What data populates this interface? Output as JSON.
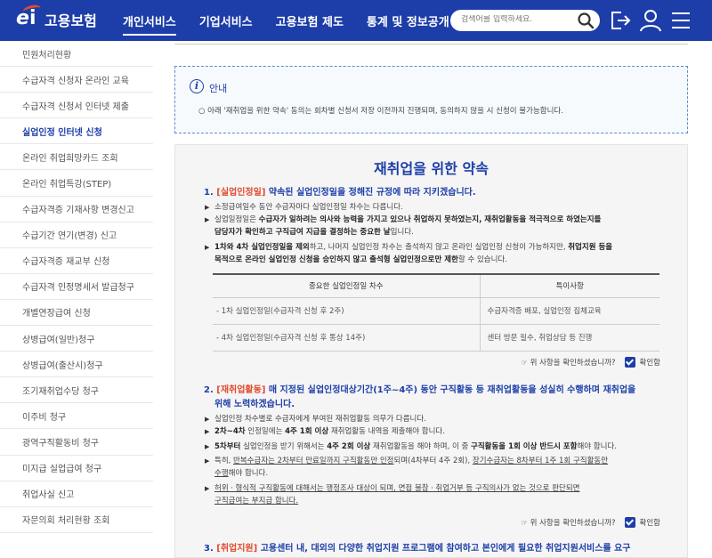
{
  "header": {
    "logo_text": "고용보험",
    "nav": [
      "개인서비스",
      "기업서비스",
      "고용보험 제도",
      "통계 및 정보공개"
    ],
    "search_placeholder": "검색어를 입력하세요."
  },
  "sidebar": {
    "items": [
      "민원처리현황",
      "수급자격 신청자 온라인 교육",
      "수급자격 신청서 인터넷 제출",
      "실업인정 인터넷 신청",
      "온라인 취업희망카드 조회",
      "온라인 취업특강(STEP)",
      "수급자격증 기재사항 변경신고",
      "수급기간 연기(변경) 신고",
      "수급자격증 재교부 신청",
      "수급자격 인정명세서 발급청구",
      "개별연장급여 신청",
      "상병급여(일반)청구",
      "상병급여(출산시)청구",
      "조기재취업수당 청구",
      "이주비 청구",
      "광역구직활동비 청구",
      "미지급 실업급여 청구",
      "취업사실 신고",
      "자문의회 처리현황 조회"
    ]
  },
  "notice": {
    "title": "안내",
    "text": "○ 아래 '재취업을 위한 약속' 동의는 회차별 신청서 저장 이전까지 진행되며, 동의하지 않을 시 신청이 불가능합니다."
  },
  "pledge": {
    "title": "재취업을 위한 약속",
    "s1": {
      "num": "1.",
      "tag": "[실업인정일]",
      "title": "약속된 실업인정일을 정해진 규정에 따라 지키겠습니다.",
      "b1": "소정급여일수 동안 수급자마다 실업인정일 차수는 다릅니다.",
      "b2a": "실업일정일은 ",
      "b2b": "수급자가 일하려는 의사와 능력을 가지고 있으나 취업하지 못하였는지, 재취업활동을 적극적으로 하였는지를",
      "b2c": "담당자가 확인하고 구직급여 지급을 결정하는 중요한 날",
      "b2d": "입니다.",
      "b3a": "1차와 4차 실업인정일을 제외",
      "b3b": "하고, 나머지 실업인정 차수는 출석하지 않고 온라인 실업인정 신청이 가능하지만, ",
      "b3c": "취업지원 등을",
      "b3d": "목적으로 온라인 실업인정 신청을 승인하지 않고 출석형 실업인정으로만 제한",
      "b3e": "할 수 있습니다.",
      "table": {
        "headers": [
          "중요한 실업인정일 차수",
          "특이사항"
        ],
        "rows": [
          [
            "- 1차 실업인정일(수급자격 신청 후 2주)",
            "수급자격증 배포, 실업인정 집체교육"
          ],
          [
            "- 4차 실업인정일(수급자격 신청 후 통상 14주)",
            "센터 방문 필수, 취업상담 등 진행"
          ]
        ]
      },
      "confirm": "☞ 위 사항을 확인하셨습니까?",
      "check": "확인함"
    },
    "s2": {
      "num": "2.",
      "tag": "[재취업활동]",
      "title1": "매 지정된 실업인정대상기간(1주~4주) 동안 구직활동 등 재취업활동을 성실히 수행하며 재취업을",
      "title2": "위해 노력하겠습니다.",
      "b1": "실업인정 차수별로 수급자에게 부여된 재취업활동 의무가 다릅니다.",
      "b2a": "2차~4차",
      "b2b": " 인정일에는 ",
      "b2c": "4주 1회 이상",
      "b2d": " 재취업활동 내역을 제출해야 합니다.",
      "b3a": "5차부터",
      "b3b": " 실업인정을 받기 위해서는 ",
      "b3c": "4주 2회 이상",
      "b3d": " 재취업활동을 해야 하며, 이 중 ",
      "b3e": "구직활동을 1회 이상 반드시 포함",
      "b3f": "해야 합니다.",
      "b4a": "특히, ",
      "b4b": "반복수급자는 2차부터 만료일까지 구직활동만 인정",
      "b4c": "되며(4차부터 4주 2회), ",
      "b4d": "장기수급자는 8차부터 1주 1회 구직활동만",
      "b4e": "수행",
      "b4f": "해야 합니다.",
      "b5a": "허위ㆍ형식적 구직활동에 대해서는 행정조사 대상이 되며, 면접 불참ㆍ취업거부 등 구직의사가 없는 것으로 판단되면",
      "b5b": "구직급여는 부지급 합니다.",
      "confirm": "☞ 위 사항을 확인하셨습니까?",
      "check": "확인함"
    },
    "s3": {
      "num": "3.",
      "tag": "[취업지원]",
      "title": "고용센터 내, 대외의 다양한 취업지원 프로그램에 참여하고 본인에게 필요한 취업지원서비스를 요구"
    }
  }
}
